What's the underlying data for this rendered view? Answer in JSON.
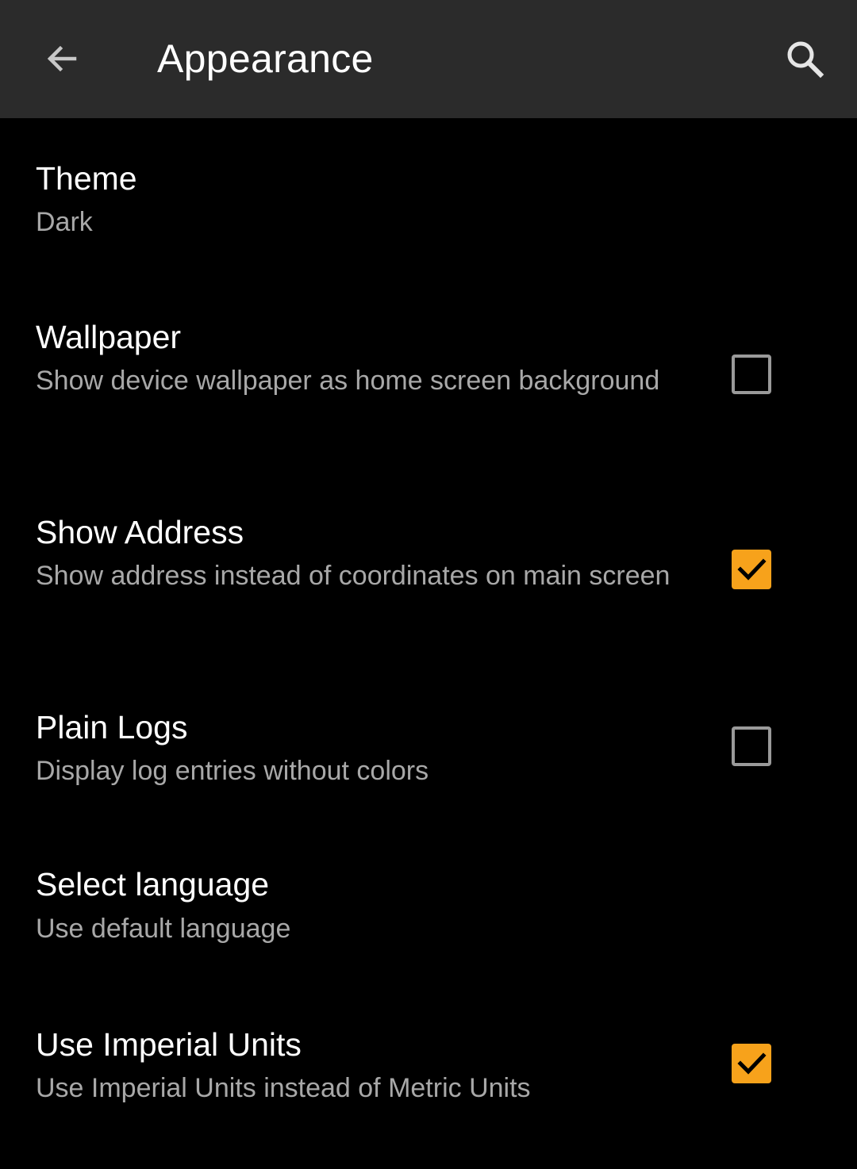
{
  "app_bar": {
    "title": "Appearance",
    "back_icon": "arrow-back-icon",
    "search_icon": "search-icon",
    "background": "#2b2b2b"
  },
  "accent_color": "#f7a21b",
  "preferences": [
    {
      "title": "Theme",
      "summary": "Dark",
      "type": "list"
    },
    {
      "title": "Wallpaper",
      "summary": "Show device wallpaper as home screen background",
      "type": "checkbox",
      "checked": false
    },
    {
      "title": "Show Address",
      "summary": "Show address instead of coordinates on main screen",
      "type": "checkbox",
      "checked": true
    },
    {
      "title": "Plain Logs",
      "summary": "Display log entries without colors",
      "type": "checkbox",
      "checked": false
    },
    {
      "title": "Select language",
      "summary": "Use default language",
      "type": "list"
    },
    {
      "title": "Use Imperial Units",
      "summary": "Use Imperial Units instead of Metric Units",
      "type": "checkbox",
      "checked": true
    }
  ]
}
